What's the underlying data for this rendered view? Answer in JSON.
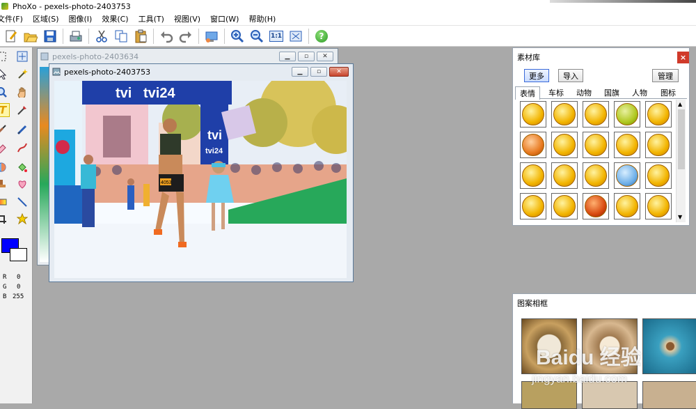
{
  "app": {
    "title": "PhoXo - pexels-photo-2403753"
  },
  "menu": [
    "文件(F)",
    "区域(S)",
    "图像(I)",
    "效果(C)",
    "工具(T)",
    "视图(V)",
    "窗口(W)",
    "帮助(H)"
  ],
  "toolbar": {
    "icons": [
      "new-icon",
      "open-icon",
      "save-icon",
      "scan-icon",
      "cut-icon",
      "copy-icon",
      "paste-icon",
      "undo-icon",
      "redo-icon",
      "screen-capture-icon",
      "zoom-in-icon",
      "zoom-out-icon",
      "actual-size-icon",
      "fit-window-icon",
      "help-icon"
    ],
    "actual_size_label": "1:1",
    "help_label": "?"
  },
  "palette": {
    "selected_tool": "text-tool",
    "foreground_color": "#0000ff",
    "background_color": "#ffffff",
    "rgb": {
      "r_label": "R",
      "r_value": "0",
      "g_label": "G",
      "g_value": "0",
      "b_label": "B",
      "b_value": "255"
    }
  },
  "windows": {
    "back": {
      "title": "pexels-photo-2403634"
    },
    "front": {
      "title": "pexels-photo-2403753"
    }
  },
  "photo": {
    "banner_brand_1": "tvi",
    "banner_brand_2": "tvi24",
    "arch_brand": "tvi",
    "arch_brand_2": "tvi24",
    "bib": "4053"
  },
  "material_library": {
    "title": "素材库",
    "close_label": "×",
    "more_label": "更多",
    "import_label": "导入",
    "manage_label": "管理",
    "tabs": [
      "表情",
      "车标",
      "动物",
      "国旗",
      "人物",
      "图标"
    ],
    "active_tab": "表情"
  },
  "pattern_frame": {
    "title": "图案相框"
  },
  "watermark": {
    "logo": "Baidu 经验",
    "url": "jingyan.baidu.com"
  }
}
